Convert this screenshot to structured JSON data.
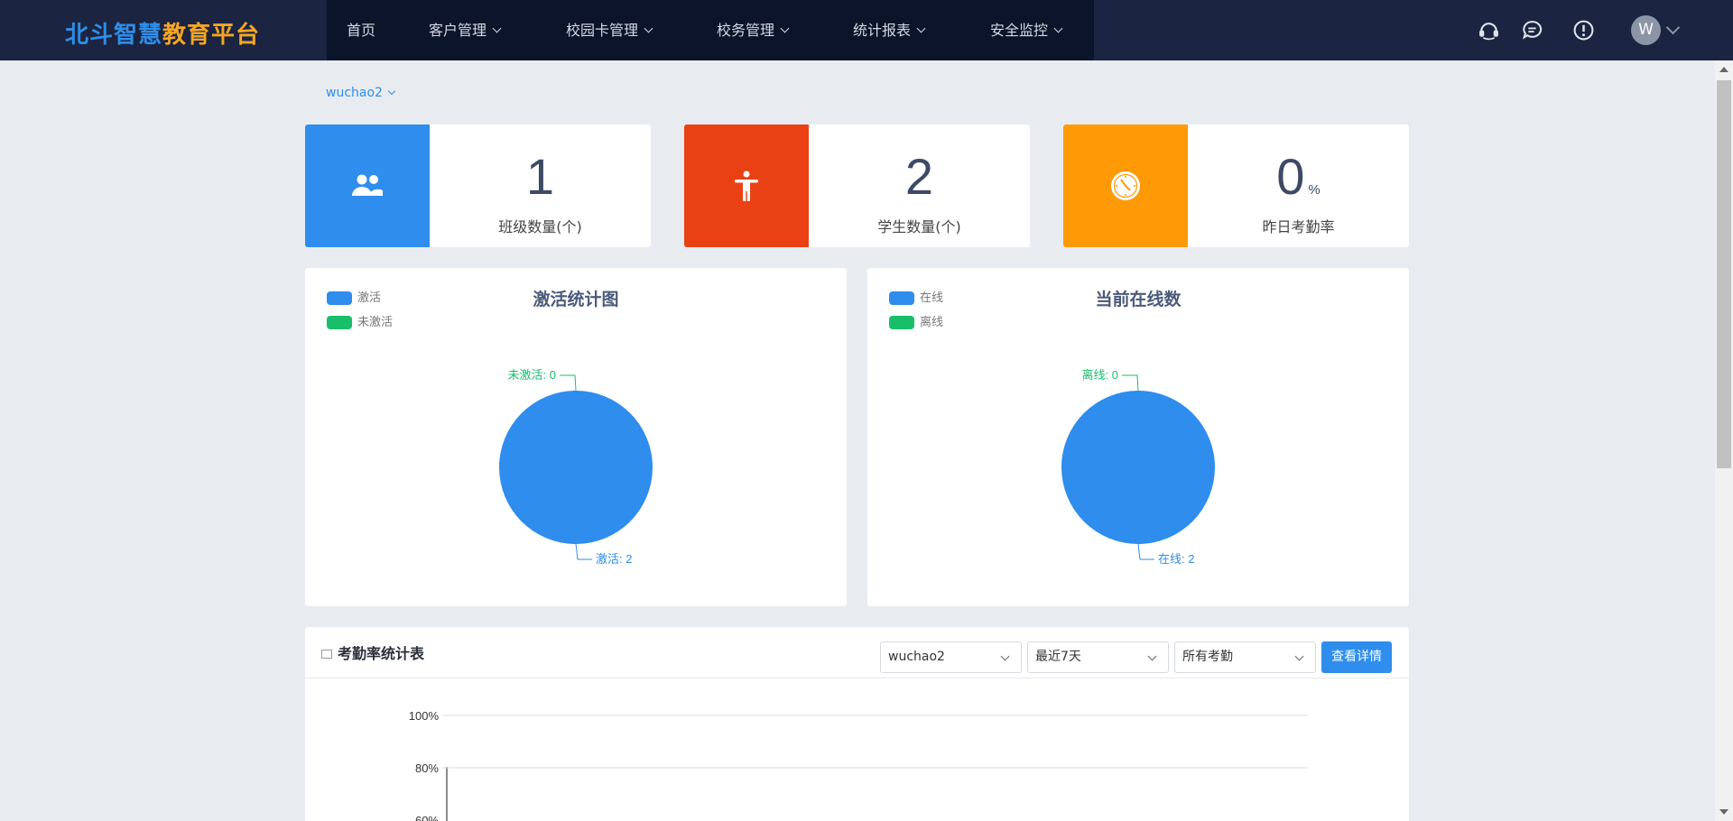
{
  "header": {
    "logo_part1": "北斗",
    "logo_part2": "智慧",
    "logo_part3": "教育平台",
    "nav": [
      {
        "label": "首页",
        "has_menu": false
      },
      {
        "label": "客户管理",
        "has_menu": true
      },
      {
        "label": "校园卡管理",
        "has_menu": true
      },
      {
        "label": "校务管理",
        "has_menu": true
      },
      {
        "label": "统计报表",
        "has_menu": true
      },
      {
        "label": "安全监控",
        "has_menu": true
      }
    ],
    "icons": [
      "headset-icon",
      "chat-icon",
      "alert-icon"
    ],
    "avatar_letter": "W"
  },
  "school_selector": "wuchao2",
  "stats": [
    {
      "value": "1",
      "unit": "",
      "label": "班级数量(个)",
      "color": "#2e8ded",
      "icon": "users-icon"
    },
    {
      "value": "2",
      "unit": "",
      "label": "学生数量(个)",
      "color": "#ea4114",
      "icon": "accessibility-icon"
    },
    {
      "value": "0",
      "unit": "%",
      "label": "昨日考勤率",
      "color": "#fe9a06",
      "icon": "clock-icon"
    }
  ],
  "panels": [
    {
      "title": "激活统计图",
      "legend": [
        {
          "label": "激活",
          "color": "#2e8ded"
        },
        {
          "label": "未激活",
          "color": "#19be6b"
        }
      ],
      "labels": {
        "primary": "激活: 2",
        "secondary": "未激活: 0"
      }
    },
    {
      "title": "当前在线数",
      "legend": [
        {
          "label": "在线",
          "color": "#2e8ded"
        },
        {
          "label": "离线",
          "color": "#19be6b"
        }
      ],
      "labels": {
        "primary": "在线: 2",
        "secondary": "离线: 0"
      }
    }
  ],
  "attendance": {
    "title": "考勤率统计表",
    "filters": [
      "wuchao2",
      "最近7天",
      "所有考勤"
    ],
    "detail_button": "查看详情"
  },
  "chart_data": [
    {
      "type": "pie",
      "title": "激活统计图",
      "categories": [
        "激活",
        "未激活"
      ],
      "values": [
        2,
        0
      ]
    },
    {
      "type": "pie",
      "title": "当前在线数",
      "categories": [
        "在线",
        "离线"
      ],
      "values": [
        2,
        0
      ]
    },
    {
      "type": "line",
      "title": "考勤率统计表",
      "yticks": [
        "100%",
        "80%",
        "60%"
      ],
      "ylim": [
        0,
        100
      ],
      "grid": true,
      "series": []
    }
  ]
}
